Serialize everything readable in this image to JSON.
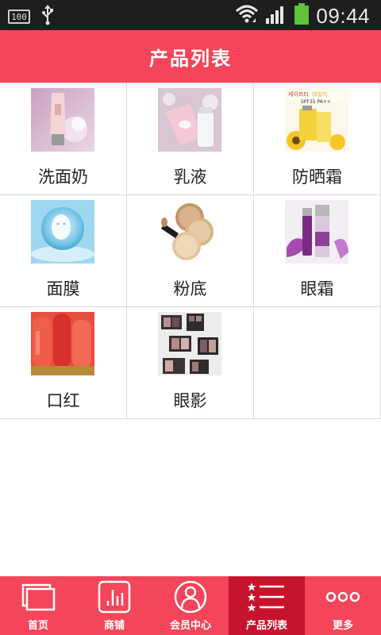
{
  "status_bar": {
    "battery_text": "100",
    "time": "09:44"
  },
  "header": {
    "title": "产品列表"
  },
  "products": [
    {
      "label": "洗面奶",
      "thumb": "cleanser-product-image"
    },
    {
      "label": "乳液",
      "thumb": "lotion-product-image"
    },
    {
      "label": "防晒霜",
      "thumb": "sunscreen-product-image"
    },
    {
      "label": "面膜",
      "thumb": "facial-mask-product-image"
    },
    {
      "label": "粉底",
      "thumb": "foundation-product-image"
    },
    {
      "label": "眼霜",
      "thumb": "eye-cream-product-image"
    },
    {
      "label": "口红",
      "thumb": "lipstick-product-image"
    },
    {
      "label": "眼影",
      "thumb": "eyeshadow-product-image"
    }
  ],
  "bottom_nav": {
    "items": [
      {
        "label": "首页",
        "icon": "home-icon"
      },
      {
        "label": "商铺",
        "icon": "shop-icon"
      },
      {
        "label": "会员中心",
        "icon": "member-icon"
      },
      {
        "label": "产品列表",
        "icon": "list-icon",
        "active": true
      },
      {
        "label": "更多",
        "icon": "more-icon"
      }
    ]
  },
  "colors": {
    "accent": "#f4455a",
    "active_tab": "#c7142e",
    "status_bar": "#1e1e1e"
  }
}
